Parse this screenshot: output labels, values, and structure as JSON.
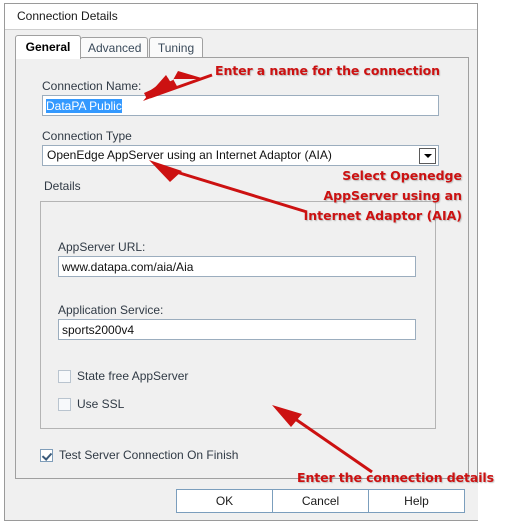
{
  "window": {
    "title": "Connection Details"
  },
  "tabs": [
    {
      "label": "General",
      "active": true
    },
    {
      "label": "Advanced",
      "active": false
    },
    {
      "label": "Tuning",
      "active": false
    }
  ],
  "form": {
    "connection_name": {
      "label": "Connection Name:",
      "value": "DataPA Public",
      "selected": true
    },
    "connection_type": {
      "label": "Connection Type",
      "value": "OpenEdge AppServer using an Internet Adaptor (AIA)",
      "dropdown_icon": "chevron-down-icon"
    },
    "details_group": {
      "caption": "Details",
      "appserver_url": {
        "label": "AppServer URL:",
        "value": "www.datapa.com/aia/Aia"
      },
      "application_service": {
        "label": "Application Service:",
        "value": "sports2000v4"
      },
      "state_free": {
        "label": "State free AppServer",
        "checked": false
      },
      "use_ssl": {
        "label": "Use SSL",
        "checked": false
      }
    },
    "test_connection": {
      "label": "Test Server Connection On Finish",
      "checked": true
    }
  },
  "buttons": {
    "ok": "OK",
    "cancel": "Cancel",
    "help": "Help"
  },
  "annotations": {
    "name": "Enter a name for the connection",
    "type_line1": "Select Openedge",
    "type_line2": "AppServer using an",
    "type_line3": "Internet Adaptor (AIA)",
    "details": "Enter the connection details",
    "color": "#cc1111"
  },
  "colors": {
    "selection": "#3399ff",
    "dialog_bg": "#f0f0f0",
    "field_border": "#9badbe",
    "annotation_red": "#cc1111"
  }
}
